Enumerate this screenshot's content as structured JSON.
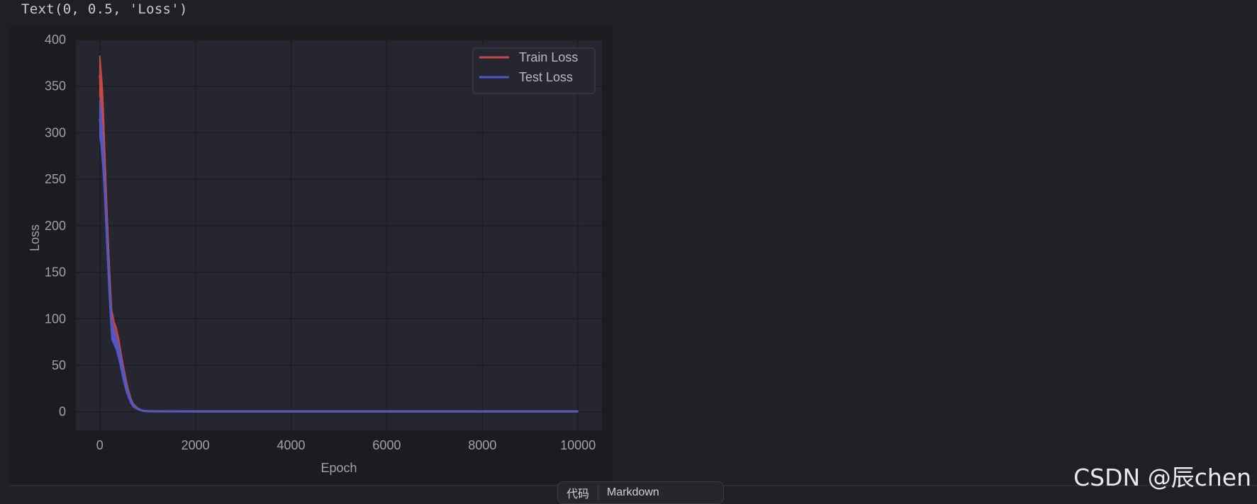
{
  "output_text": "Text(0, 0.5, 'Loss')",
  "watermark": "CSDN @辰chen",
  "bottom_bar": {
    "left_label": "代码",
    "right_label": "Markdown"
  },
  "colors": {
    "train": "#c44a47",
    "test": "#5257c6",
    "plot_bg": "#25262f",
    "grid": "#1c1d22"
  },
  "chart_data": {
    "type": "line",
    "title": "",
    "xlabel": "Epoch",
    "ylabel": "Loss",
    "xlim": [
      -500,
      10500
    ],
    "ylim": [
      -20,
      400
    ],
    "xticks": [
      0,
      2000,
      4000,
      6000,
      8000,
      10000
    ],
    "yticks": [
      0,
      50,
      100,
      150,
      200,
      250,
      300,
      350,
      400
    ],
    "grid": true,
    "legend_position": "top-right",
    "series": [
      {
        "name": "Train Loss",
        "color": "#c44a47",
        "x": [
          0,
          20,
          40,
          60,
          80,
          100,
          150,
          200,
          250,
          300,
          350,
          400,
          450,
          500,
          550,
          600,
          650,
          700,
          800,
          900,
          1000,
          1100,
          2000,
          4000,
          6000,
          8000,
          10000
        ],
        "upper": [
          383,
          372,
          360,
          345,
          320,
          290,
          220,
          160,
          110,
          97,
          90,
          78,
          62,
          48,
          35,
          24,
          15,
          9,
          4,
          1.5,
          0.8,
          0.6,
          0.5,
          0.5,
          0.5,
          0.5,
          0.5
        ],
        "lower": [
          340,
          330,
          318,
          300,
          280,
          255,
          190,
          130,
          80,
          74,
          68,
          58,
          46,
          34,
          24,
          16,
          10,
          6,
          2.5,
          0.8,
          0.4,
          0.3,
          0.3,
          0.3,
          0.3,
          0.3,
          0.3
        ]
      },
      {
        "name": "Test Loss",
        "color": "#5257c6",
        "x": [
          0,
          20,
          40,
          60,
          80,
          100,
          150,
          200,
          250,
          300,
          350,
          400,
          450,
          500,
          550,
          600,
          650,
          700,
          800,
          900,
          1000,
          1100,
          2000,
          4000,
          6000,
          8000,
          10000
        ],
        "upper": [
          335,
          326,
          314,
          300,
          280,
          258,
          200,
          145,
          98,
          88,
          80,
          70,
          56,
          43,
          31,
          21,
          13,
          8,
          3.5,
          1.4,
          0.9,
          0.7,
          0.6,
          0.6,
          0.6,
          0.6,
          0.6
        ],
        "lower": [
          295,
          288,
          278,
          265,
          248,
          230,
          175,
          120,
          78,
          72,
          66,
          56,
          44,
          32,
          22,
          15,
          9,
          5,
          2,
          0.8,
          0.5,
          0.4,
          0.4,
          0.4,
          0.4,
          0.4,
          0.4
        ]
      }
    ]
  }
}
